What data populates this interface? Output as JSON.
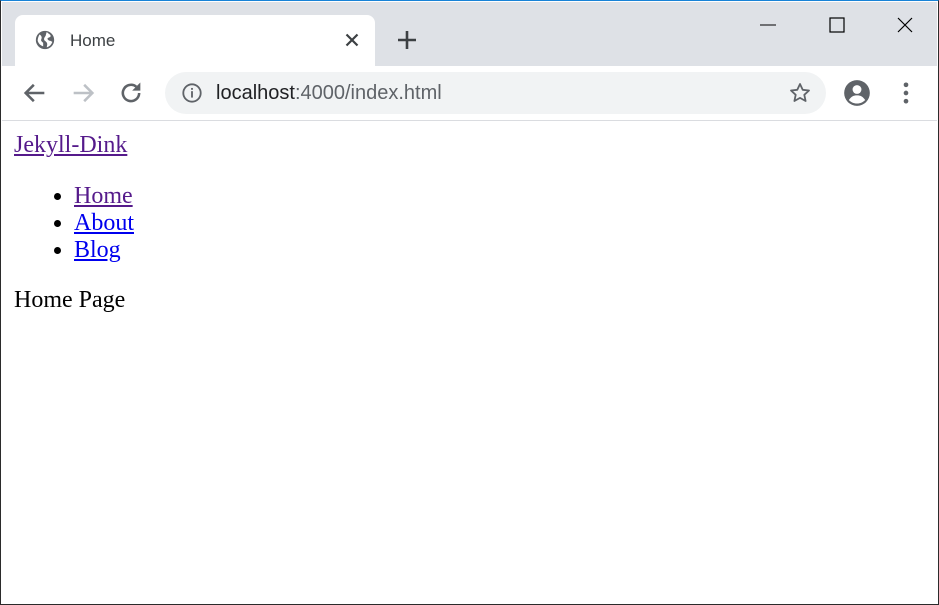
{
  "browser": {
    "tab_title": "Home",
    "url_host": "localhost",
    "url_rest": ":4000/index.html",
    "icons": [
      "globe-icon",
      "close-icon",
      "plus-icon",
      "minimize-icon",
      "maximize-icon",
      "window-close-icon",
      "back-icon",
      "forward-icon",
      "reload-icon",
      "info-icon",
      "star-icon",
      "account-icon",
      "menu-icon"
    ]
  },
  "page": {
    "site_title": "Jekyll-Dink",
    "nav": [
      {
        "label": "Home",
        "visited": true
      },
      {
        "label": "About",
        "visited": false
      },
      {
        "label": "Blog",
        "visited": false
      }
    ],
    "body_text": "Home Page"
  },
  "colors": {
    "visited_link": "#551a8b",
    "link": "#0000ee",
    "tabbar": "#dee1e6",
    "omnibox": "#f1f3f4"
  }
}
